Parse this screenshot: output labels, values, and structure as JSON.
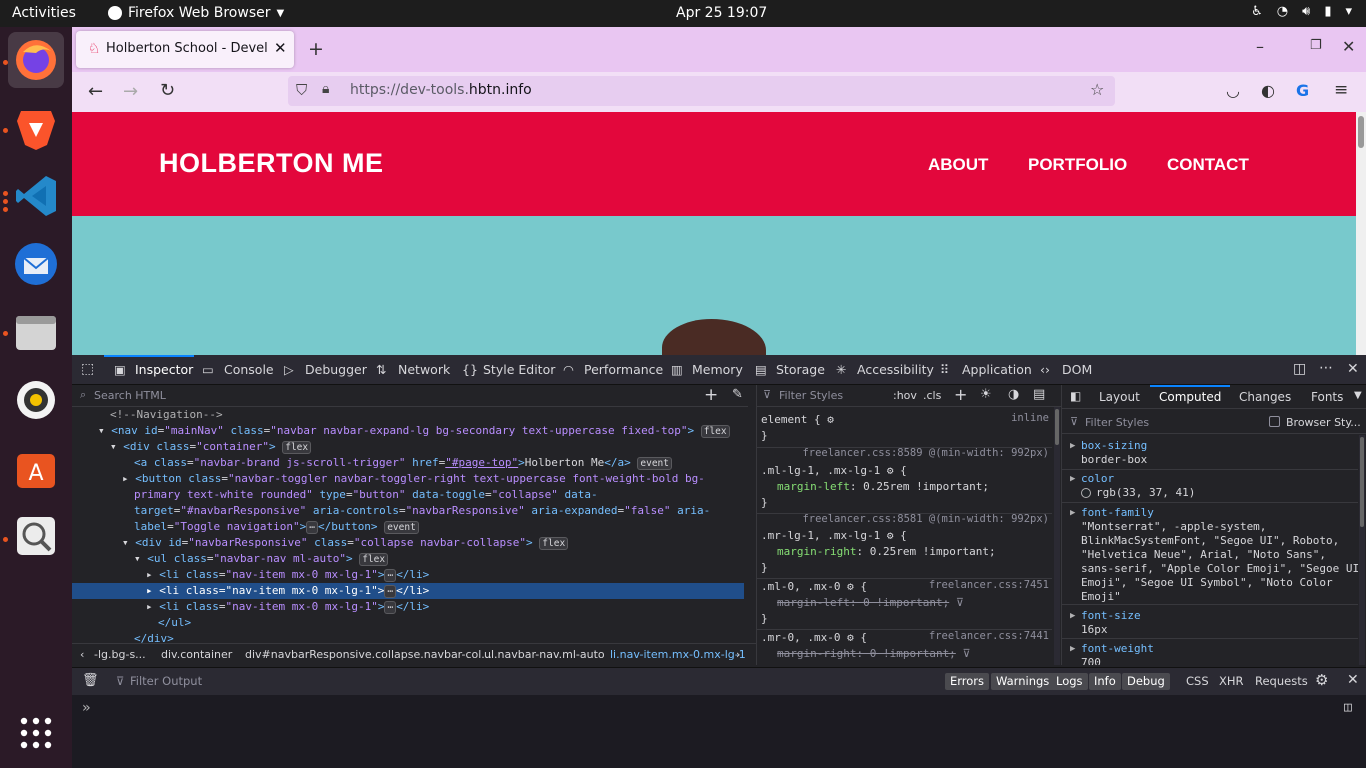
{
  "system": {
    "activities": "Activities",
    "app_name": "Firefox Web Browser",
    "clock": "Apr 25  19:07"
  },
  "browser": {
    "tab_title": "Holberton School - Devel",
    "url_prefix": "https://dev-tools.",
    "url_domain": "hbtn.info"
  },
  "page": {
    "brand": "HOLBERTON ME",
    "nav": [
      "ABOUT",
      "PORTFOLIO",
      "CONTACT"
    ],
    "colors": {
      "header": "#e3073c",
      "background": "#78c9cc"
    }
  },
  "devtools": {
    "tabs": [
      "Inspector",
      "Console",
      "Debugger",
      "Network",
      "Style Editor",
      "Performance",
      "Memory",
      "Storage",
      "Accessibility",
      "Application",
      "DOM"
    ],
    "search_placeholder": "Search HTML",
    "breadcrumbs": [
      "-lg.bg-s...",
      "div.container",
      "div#navbarResponsive.collapse.navbar-col...",
      "ul.navbar-nav.ml-auto",
      "li.nav-item.mx-0.mx-lg-1"
    ],
    "rules": {
      "filter_placeholder": "Filter Styles",
      "hov": ":hov",
      "cls": ".cls",
      "element_selector": "element {",
      "element_src": "inline",
      "r1_src": "freelancer.css:8589 @(min-width: 992px)",
      "r1_selector": ".ml-lg-1, .mx-lg-1",
      "r1_prop": "margin-left",
      "r1_val": "0.25rem !important;",
      "r2_src": "freelancer.css:8581 @(min-width: 992px)",
      "r2_selector": ".mr-lg-1, .mx-lg-1",
      "r2_prop": "margin-right",
      "r2_val": "0.25rem !important;",
      "r3_selector": ".ml-0, .mx-0",
      "r3_src": "freelancer.css:7451",
      "r3_decl": "margin-left: 0 !important;",
      "r4_selector": ".mr-0, .mx-0",
      "r4_src": "freelancer.css:7441",
      "r4_decl": "margin-right: 0 !important;"
    },
    "computed": {
      "tabs": [
        "Layout",
        "Computed",
        "Changes",
        "Fonts"
      ],
      "filter_placeholder": "Filter Styles",
      "browser_styles": "Browser Sty...",
      "props": [
        {
          "name": "box-sizing",
          "value": "border-box"
        },
        {
          "name": "color",
          "value": "rgb(33, 37, 41)"
        },
        {
          "name": "font-family",
          "value": "\"Montserrat\", -apple-system, BlinkMacSystemFont, \"Segoe UI\", Roboto, \"Helvetica Neue\", Arial, \"Noto Sans\", sans-serif, \"Apple Color Emoji\", \"Segoe UI Emoji\", \"Segoe UI Symbol\", \"Noto Color Emoji\""
        },
        {
          "name": "font-size",
          "value": "16px"
        },
        {
          "name": "font-weight",
          "value": "700"
        }
      ]
    },
    "console": {
      "filter_placeholder": "Filter Output",
      "levels": [
        "Errors",
        "Warnings",
        "Logs",
        "Info",
        "Debug"
      ],
      "types": [
        "CSS",
        "XHR",
        "Requests"
      ]
    }
  }
}
